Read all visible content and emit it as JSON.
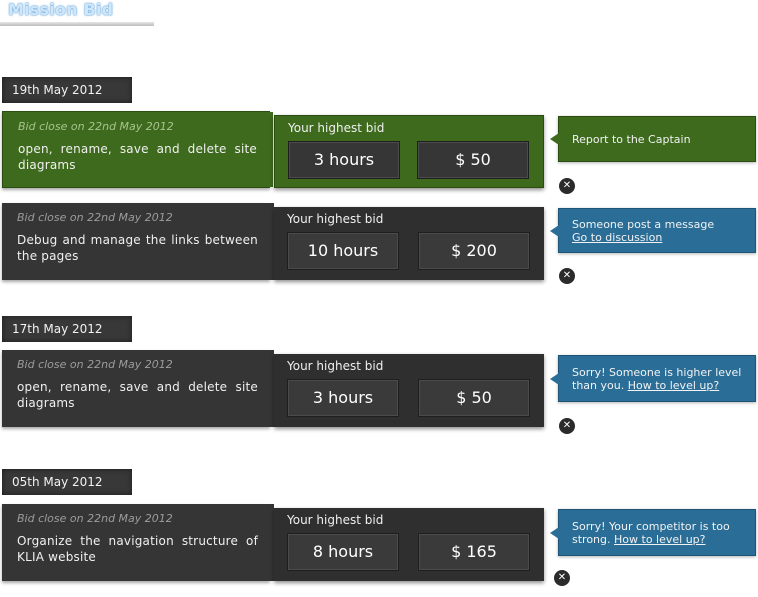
{
  "page": {
    "title": "Mission Bid"
  },
  "dates": [
    "19th May 2012",
    "17th May 2012",
    "05th May 2012"
  ],
  "bid_heading": "Your highest bid",
  "bids": [
    {
      "close_text": "Bid close on 22nd May 2012",
      "description": "open, rename, save and delete site diagrams",
      "hours": "3 hours",
      "amount": "$ 50",
      "status_color": "green",
      "notice": {
        "text": "Report to the Captain",
        "link": ""
      }
    },
    {
      "close_text": "Bid close on 22nd May 2012",
      "description": "Debug and manage the links between the pages",
      "hours": "10 hours",
      "amount": "$ 200",
      "status_color": "blue",
      "notice": {
        "text": "Someone post a message",
        "link": "Go to discussion"
      }
    },
    {
      "close_text": "Bid close on 22nd May 2012",
      "description": "open, rename, save and delete site diagrams",
      "hours": "3 hours",
      "amount": "$ 50",
      "status_color": "blue",
      "notice": {
        "text": "Sorry! Someone is higher level than you.",
        "link": "How to level up?"
      }
    },
    {
      "close_text": "Bid close on 22nd May 2012",
      "description": "Organize the navigation structure of KLIA website",
      "hours": "8 hours",
      "amount": "$ 165",
      "status_color": "blue",
      "notice": {
        "text": "Sorry! Your competitor is too strong.",
        "link": "How to level up?"
      }
    }
  ],
  "icons": {
    "close": "close-icon"
  },
  "colors": {
    "green": "#3d6a1c",
    "blue": "#2a6e98",
    "dark": "#353535"
  }
}
